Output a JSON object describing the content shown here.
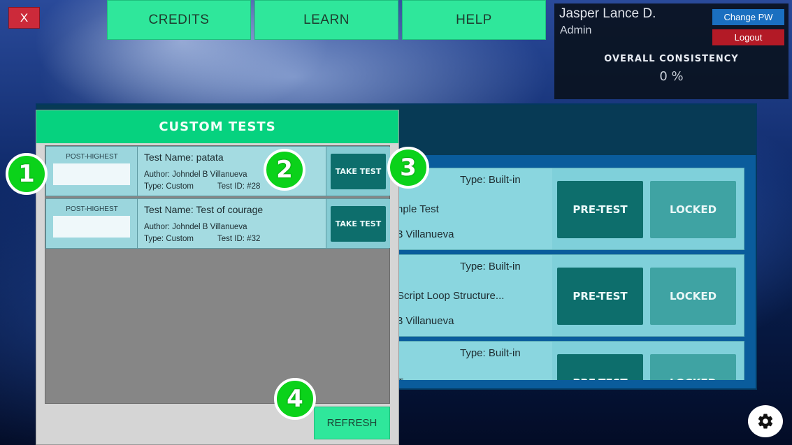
{
  "top_nav": {
    "close_label": "X",
    "credits_label": "CREDITS",
    "learn_label": "LEARN",
    "help_label": "HELP"
  },
  "user": {
    "name": "Jasper Lance D.",
    "role": "Admin",
    "change_pw_label": "Change PW",
    "logout_label": "Logout",
    "consistency_label": "OVERALL CONSISTENCY",
    "consistency_value": "0 %"
  },
  "builtin_tests": [
    {
      "type": "Type: Built-in",
      "title": "nple Test",
      "author": "3 Villanueva",
      "pretest_label": "PRE-TEST",
      "locked_label": "LOCKED"
    },
    {
      "type": "Type: Built-in",
      "title": "Script Loop Structure...",
      "author": "3 Villanueva",
      "pretest_label": "PRE-TEST",
      "locked_label": "LOCKED"
    },
    {
      "type": "Type: Built-in",
      "title": "Te",
      "author": "",
      "pretest_label": "PRE-TEST",
      "locked_label": "LOCKED"
    }
  ],
  "custom_tests": {
    "header": "CUSTOM TESTS",
    "refresh_label": "REFRESH",
    "rows": [
      {
        "score_label": "POST-HIGHEST",
        "name": "Test Name: patata",
        "author": "Author: Johndel B Villanueva",
        "type": "Type: Custom",
        "test_id": "Test ID: #28",
        "action_label": "TAKE TEST"
      },
      {
        "score_label": "POST-HIGHEST",
        "name": "Test Name: Test of courage",
        "author": "Author: Johndel B Villanueva",
        "type": "Type: Custom",
        "test_id": "Test ID: #32",
        "action_label": "TAKE TEST"
      }
    ]
  },
  "badges": [
    "1",
    "2",
    "3",
    "4"
  ],
  "colors": {
    "accent_green": "#2fe79b",
    "header_green": "#06d27f",
    "teal_button": "#0d6e6c",
    "danger": "#cc2a3a",
    "badge_green": "#0bd21a"
  },
  "icons": {
    "settings": "gear-icon"
  }
}
